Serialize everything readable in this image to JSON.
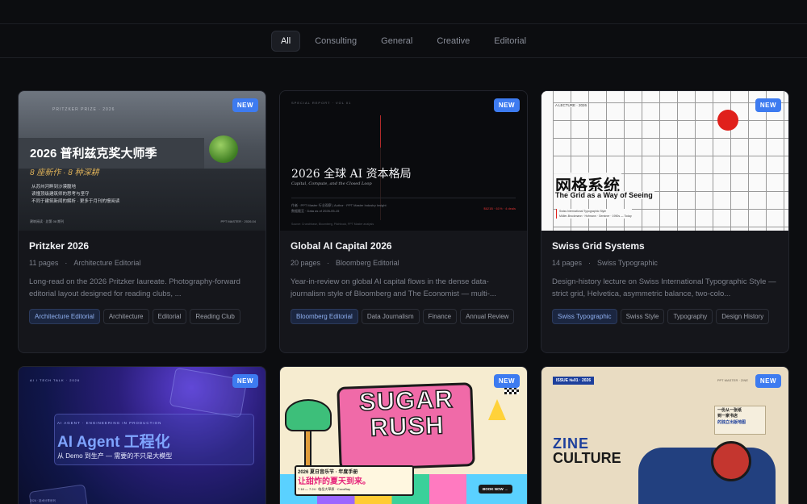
{
  "filters": {
    "items": [
      "All",
      "Consulting",
      "General",
      "Creative",
      "Editorial"
    ],
    "active": "All"
  },
  "cards": [
    {
      "badge": "NEW",
      "title": "Pritzker 2026",
      "pages": "11 pages",
      "category": "Architecture Editorial",
      "description": "Long-read on the 2026 Pritzker laureate. Photography-forward editorial layout designed for reading clubs, ...",
      "tags": [
        "Architecture Editorial",
        "Architecture",
        "Editorial",
        "Reading Club"
      ],
      "thumb": {
        "kicker": "PRITZKER PRIZE · 2026",
        "heading": "2026 普利兹克奖大师季",
        "subheading": "8 座新作 · 8 种深耕",
        "line1": "从苏州河畔到沙漠腹地",
        "line2": "读懂顶级建筑师的思考与坚守",
        "line3": "不同于建筑新闻的解析 · 更多于月刊的慢阅读",
        "footer_left": "建筑阅读 · 总第 08 期刊",
        "footer_right": "PPT MASTER · 2026.04"
      }
    },
    {
      "badge": "NEW",
      "title": "Global AI Capital 2026",
      "pages": "20 pages",
      "category": "Bloomberg Editorial",
      "description": "Year-in-review on global AI capital flows in the dense data-journalism style of Bloomberg and The Economist — multi-...",
      "tags": [
        "Bloomberg Editorial",
        "Data Journalism",
        "Finance",
        "Annual Review"
      ],
      "thumb": {
        "kicker": "SPECIAL REPORT · VOL 01",
        "heading": "2026 全球 AI 资本格局",
        "subheading": "Capital, Compute, and the Closed Loop",
        "meta1": "作者 · PPT Master 行业观察 | Author · PPT Master Industry Insight",
        "meta2": "数据截至 · Data as of 2026-05-15",
        "red": "$621B · 61% · 4 deals",
        "footer": "Source: Crunchbase, Bloomberg, Pitchbook, PPT Master analysis"
      }
    },
    {
      "badge": "NEW",
      "title": "Swiss Grid Systems",
      "pages": "14 pages",
      "category": "Swiss Typographic",
      "description": "Design-history lecture on Swiss International Typographic Style — strict grid, Helvetica, asymmetric balance, two-colo...",
      "tags": [
        "Swiss Typographic",
        "Swiss Style",
        "Typography",
        "Design History"
      ],
      "thumb": {
        "kicker": "A LECTURE · 2026",
        "heading": "网格系统",
        "subheading": "The Grid as a Way of Seeing",
        "small1": "Swiss International Typographic Style",
        "small2": "Müller-Brockmann · Hofmann · Gerstner · 1950s — Today"
      }
    },
    {
      "badge": "NEW",
      "thumb": {
        "kicker": "AI / TECH TALK · 2026",
        "label": "AI AGENT · ENGINEERING IN PRODUCTION",
        "heading": "AI Agent 工程化",
        "subheading": "从 Demo 到生产 — 需要的不只是大模型",
        "footer": "2026 · 技术分享系列"
      }
    },
    {
      "badge": "NEW",
      "thumb": {
        "word1": "SUGAR",
        "word2": "RUSH",
        "line1": "2026 夏日音乐节 · 年度手册",
        "line2": "让甜炸的夏天到来。",
        "line3": "7.18 — 7.24 · 临岳大草原 · CocoBay",
        "cta": "BOOK NOW →"
      }
    },
    {
      "badge": "NEW",
      "thumb": {
        "issue": "ISSUE №01 · 2026",
        "kicker": "PPT MASTER · ZINE",
        "word1": "ZINE",
        "word2": "CULTURE",
        "note1": "一份从一张纸",
        "note2": "到一家书店",
        "note3": "的独立出版地图"
      }
    }
  ]
}
